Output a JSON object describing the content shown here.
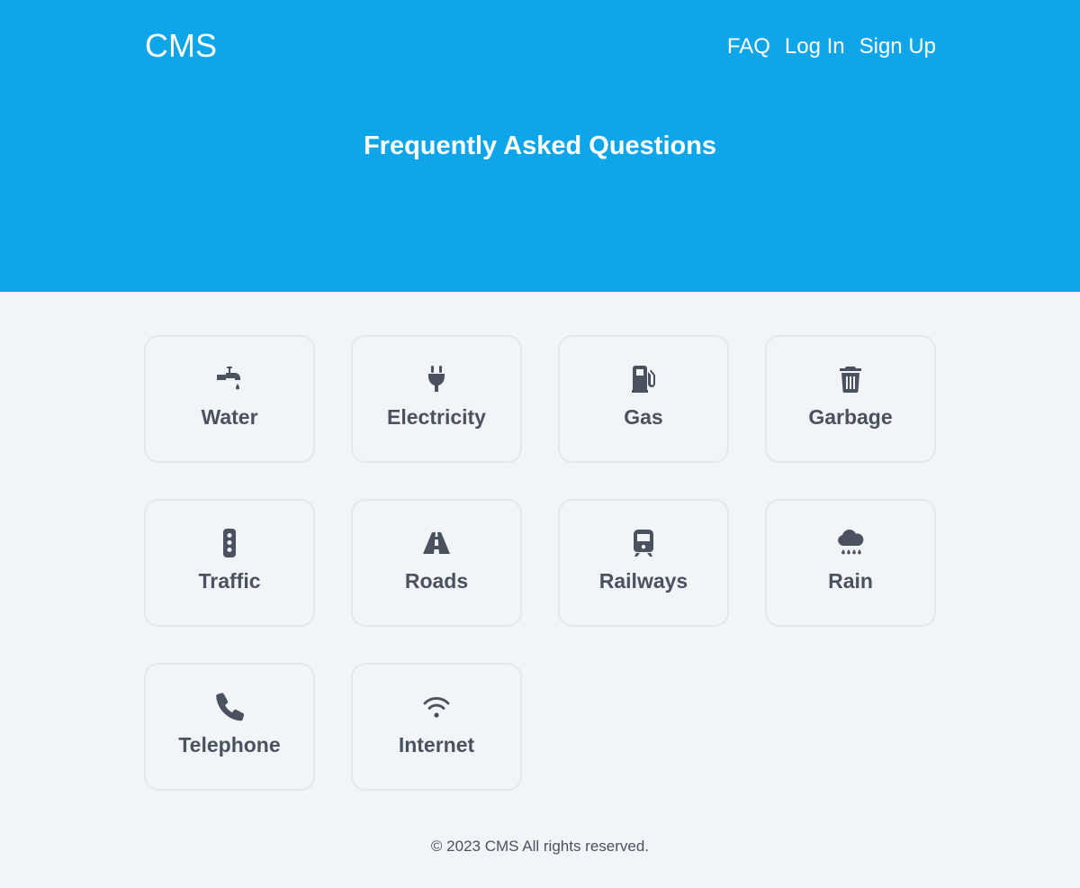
{
  "header": {
    "brand": "CMS",
    "nav": [
      "FAQ",
      "Log In",
      "Sign Up"
    ]
  },
  "hero": {
    "title": "Frequently Asked Questions"
  },
  "categories": [
    {
      "label": "Water",
      "icon": "faucet-icon"
    },
    {
      "label": "Electricity",
      "icon": "plug-icon"
    },
    {
      "label": "Gas",
      "icon": "gas-pump-icon"
    },
    {
      "label": "Garbage",
      "icon": "trash-icon"
    },
    {
      "label": "Traffic",
      "icon": "traffic-light-icon"
    },
    {
      "label": "Roads",
      "icon": "road-icon"
    },
    {
      "label": "Railways",
      "icon": "train-icon"
    },
    {
      "label": "Rain",
      "icon": "cloud-rain-icon"
    },
    {
      "label": "Telephone",
      "icon": "phone-icon"
    },
    {
      "label": "Internet",
      "icon": "wifi-icon"
    }
  ],
  "footer": {
    "text": "© 2023 CMS All rights reserved."
  },
  "colors": {
    "accent": "#0ea5e9",
    "background": "#f1f5f8",
    "text": "#4a5260"
  }
}
